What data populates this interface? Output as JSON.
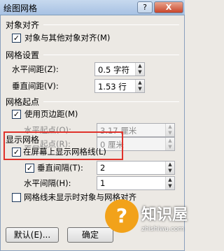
{
  "window": {
    "title": "绘图网格",
    "help_label": "?",
    "close_label": "X"
  },
  "snap": {
    "heading": "对象对齐",
    "snap_to_objects": {
      "label": "对象与其他对象对齐(M)",
      "checked": true
    }
  },
  "grid_settings": {
    "heading": "网格设置",
    "horizontal_spacing": {
      "label": "水平间距(Z):",
      "value": "0.5 字符"
    },
    "vertical_spacing": {
      "label": "垂直间距(V):",
      "value": "1.53 行"
    }
  },
  "grid_origin": {
    "heading": "网格起点",
    "use_margins": {
      "label": "使用页边距(M)",
      "checked": true
    },
    "horizontal_origin": {
      "label": "水平起点(O):",
      "value": "3.17 厘米"
    },
    "vertical_origin": {
      "label": "垂直起点(R):",
      "value": "0 厘米"
    }
  },
  "show_grid": {
    "heading": "显示网格",
    "display_gridlines": {
      "label": "在屏幕上显示网格线(L)",
      "checked": true
    },
    "vertical_every": {
      "label": "垂直间隔(T):",
      "value": "2",
      "checked": true
    },
    "horizontal_every": {
      "label": "水平间隔(H):",
      "value": "1"
    },
    "hide_when_not_visible": {
      "label": "网格线未显示时对象与网格对齐",
      "checked": false
    }
  },
  "buttons": {
    "default_label": "默认(E)...",
    "ok_label": "确定"
  },
  "watermark": {
    "brand": "知识屋",
    "url": "zhishiwu.com"
  },
  "colors": {
    "highlight": "#e0322b",
    "watermark": "#f2a21a"
  }
}
